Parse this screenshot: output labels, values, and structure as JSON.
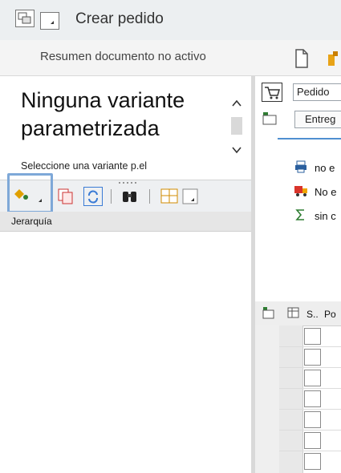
{
  "titlebar": {
    "title": "Crear pedido",
    "menu_icon": "window-menu-icon",
    "dropdown_icon": "chevron-down-icon"
  },
  "toolbar2": {
    "status_text": "Resumen documento no activo",
    "icons": [
      "new-document-icon",
      "other-doc-icon"
    ]
  },
  "left_pane": {
    "variant_title": "Ninguna variante parametrizada",
    "variant_hint": "Seleccione una variante p.el",
    "toolbar_icons": [
      "expand-tree-icon",
      "copy-icon",
      "refresh-icon",
      "binoculars-icon",
      "layout-icon"
    ],
    "hierarchy_header": "Jerarquía"
  },
  "right_pane": {
    "order_type_value": "Pedido",
    "delivery_button_label": "Entreg",
    "status_lines": [
      {
        "icon": "printer-icon",
        "text": "no e"
      },
      {
        "icon": "truck-icon",
        "text": "No e"
      },
      {
        "icon": "sum-icon",
        "text": "sin c"
      }
    ],
    "grid_headers": [
      "S..",
      "Po"
    ]
  },
  "colors": {
    "selection_outline": "#7ea8d8",
    "accent_line": "#4f8fd0"
  }
}
